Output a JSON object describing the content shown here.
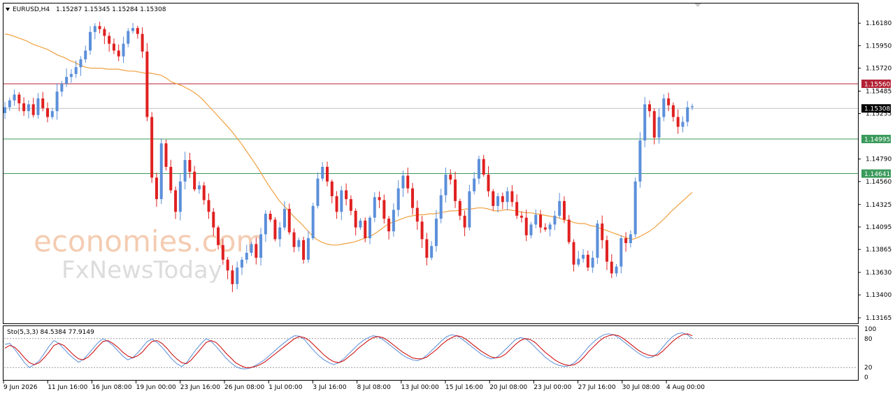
{
  "chart_data": [
    {
      "type": "candlestick",
      "symbol": "EURUSD,H4",
      "ohlc_readout": "1.15287 1.15345 1.15284 1.15308",
      "ylim": [
        1.1313,
        1.1636
      ],
      "y_ticks": [
        "1.16180",
        "1.15950",
        "1.15720",
        "1.15485",
        "1.15255",
        "1.14790",
        "1.14560",
        "1.14325",
        "1.14095",
        "1.13865",
        "1.13630",
        "1.13400",
        "1.13165"
      ],
      "x_labels": [
        "9 Jun 2026",
        "11 Jun 16:00",
        "16 Jun 08:00",
        "19 Jun 00:00",
        "23 Jun 16:00",
        "26 Jun 08:00",
        "1 Jul 00:00",
        "3 Jul 16:00",
        "8 Jul 08:00",
        "13 Jul 00:00",
        "15 Jul 16:00",
        "20 Jul 08:00",
        "23 Jul 00:00",
        "27 Jul 16:00",
        "30 Jul 08:00",
        "4 Aug 00:00"
      ],
      "horizontal_lines": [
        {
          "label": "1.15560",
          "value": 1.1556,
          "color": "#b22234"
        },
        {
          "label": "1.15308",
          "value": 1.15308,
          "color": "#000000"
        },
        {
          "label": "1.14995",
          "value": 1.14995,
          "color": "#3a9a5b"
        },
        {
          "label": "1.14641",
          "value": 1.14641,
          "color": "#3a9a5b"
        }
      ],
      "moving_average_color": "#f0a040",
      "bull_color": "#5b8fd9",
      "bear_color": "#e02020",
      "closes": [
        1.1532,
        1.1539,
        1.1545,
        1.1536,
        1.1528,
        1.1535,
        1.1524,
        1.1541,
        1.1531,
        1.1522,
        1.1528,
        1.1548,
        1.1556,
        1.1563,
        1.1566,
        1.1573,
        1.1581,
        1.159,
        1.1609,
        1.1615,
        1.1612,
        1.1605,
        1.1597,
        1.159,
        1.1584,
        1.1597,
        1.161,
        1.1613,
        1.1607,
        1.1589,
        1.1522,
        1.146,
        1.1438,
        1.1495,
        1.1471,
        1.1447,
        1.1425,
        1.1456,
        1.1478,
        1.1466,
        1.1448,
        1.1452,
        1.1437,
        1.1425,
        1.1409,
        1.1391,
        1.1376,
        1.1365,
        1.1351,
        1.1368,
        1.1376,
        1.1383,
        1.1392,
        1.1378,
        1.1402,
        1.1423,
        1.1417,
        1.1397,
        1.1409,
        1.1428,
        1.1404,
        1.1389,
        1.1396,
        1.1376,
        1.1398,
        1.1431,
        1.1459,
        1.1471,
        1.1456,
        1.1441,
        1.1425,
        1.1447,
        1.1438,
        1.1426,
        1.1409,
        1.1416,
        1.1398,
        1.1419,
        1.144,
        1.1437,
        1.1418,
        1.1405,
        1.1427,
        1.1449,
        1.1462,
        1.1449,
        1.1429,
        1.1415,
        1.1397,
        1.1378,
        1.139,
        1.1418,
        1.1442,
        1.1463,
        1.1458,
        1.1436,
        1.1421,
        1.1409,
        1.1446,
        1.1459,
        1.1479,
        1.1463,
        1.1446,
        1.1431,
        1.1441,
        1.1435,
        1.1446,
        1.1435,
        1.1421,
        1.1419,
        1.1401,
        1.1412,
        1.1422,
        1.1409,
        1.1407,
        1.1412,
        1.1421,
        1.1436,
        1.1417,
        1.1394,
        1.1371,
        1.1377,
        1.1381,
        1.1368,
        1.1378,
        1.1413,
        1.1396,
        1.1374,
        1.1362,
        1.1369,
        1.1398,
        1.1393,
        1.1402,
        1.1456,
        1.1498,
        1.1535,
        1.1528,
        1.1501,
        1.1522,
        1.1541,
        1.1534,
        1.1522,
        1.1512,
        1.1517,
        1.1532,
        1.1533
      ],
      "ma_values": [
        1.1607,
        1.1606,
        1.1604,
        1.1602,
        1.16,
        1.1597,
        1.1595,
        1.1593,
        1.1591,
        1.1588,
        1.1585,
        1.1583,
        1.158,
        1.1578,
        1.1575,
        1.1573,
        1.1572,
        1.1572,
        1.1572,
        1.1571,
        1.1571,
        1.1571,
        1.157,
        1.1569,
        1.1569,
        1.1568,
        1.1567,
        1.1567,
        1.1566,
        1.1565,
        1.1562,
        1.1558,
        1.1556,
        1.1554,
        1.1551,
        1.1548,
        1.1544,
        1.1539,
        1.1533,
        1.1527,
        1.1521,
        1.1515,
        1.1509,
        1.1502,
        1.1495,
        1.1487,
        1.1479,
        1.1471,
        1.1462,
        1.1453,
        1.1445,
        1.1437,
        1.1431,
        1.1425,
        1.1419,
        1.1414,
        1.1408,
        1.1402,
        1.1397,
        1.1394,
        1.1392,
        1.1391,
        1.1391,
        1.1392,
        1.1393,
        1.1394,
        1.1396,
        1.1398,
        1.14,
        1.1403,
        1.1407,
        1.1411,
        1.1414,
        1.1416,
        1.1418,
        1.142,
        1.1421,
        1.1422,
        1.1422,
        1.1423,
        1.1423,
        1.1424,
        1.1425,
        1.1426,
        1.1426,
        1.1427,
        1.1428,
        1.1428,
        1.1429,
        1.1429,
        1.1428,
        1.1426,
        1.1426,
        1.1427,
        1.1427,
        1.1426,
        1.1425,
        1.1424,
        1.1424,
        1.1423,
        1.1422,
        1.1421,
        1.142,
        1.1419,
        1.1417,
        1.1416,
        1.1414,
        1.1413,
        1.1413,
        1.1411,
        1.141,
        1.1408,
        1.1406,
        1.1404,
        1.1402,
        1.14,
        1.1398,
        1.1397,
        1.1399,
        1.1402,
        1.1405,
        1.1409,
        1.1414,
        1.1419,
        1.1425,
        1.143,
        1.1435,
        1.144,
        1.1445
      ]
    },
    {
      "type": "line",
      "name": "Sto(5,3,3) 84.5384 77.9149",
      "ylim": [
        0,
        100
      ],
      "y_ticks": [
        "100",
        "80",
        "20",
        "0"
      ],
      "levels": [
        80,
        20
      ],
      "main_color": "#5b8fd9",
      "signal_color": "#cc0000",
      "main": [
        68,
        70,
        58,
        44,
        30,
        20,
        26,
        34,
        49,
        64,
        76,
        70,
        59,
        48,
        39,
        31,
        37,
        48,
        60,
        72,
        80,
        74,
        66,
        55,
        44,
        36,
        40,
        50,
        62,
        74,
        79,
        72,
        62,
        50,
        38,
        28,
        22,
        30,
        44,
        58,
        70,
        80,
        74,
        64,
        52,
        40,
        30,
        22,
        18,
        17,
        19,
        24,
        30,
        37,
        46,
        55,
        64,
        72,
        80,
        86,
        85,
        78,
        66,
        54,
        44,
        36,
        30,
        26,
        30,
        38,
        48,
        58,
        68,
        76,
        82,
        86,
        84,
        78,
        70,
        62,
        54,
        46,
        40,
        36,
        34,
        38,
        46,
        56,
        66,
        76,
        84,
        88,
        86,
        80,
        72,
        64,
        56,
        48,
        42,
        38,
        40,
        48,
        58,
        68,
        78,
        82,
        80,
        72,
        62,
        52,
        42,
        34,
        28,
        24,
        22,
        24,
        30,
        40,
        52,
        64,
        74,
        82,
        88,
        90,
        88,
        82,
        74,
        66,
        58,
        50,
        44,
        40,
        42,
        50,
        62,
        74,
        84,
        90,
        92,
        88,
        80
      ],
      "signal": [
        60,
        66,
        62,
        52,
        40,
        30,
        26,
        30,
        40,
        52,
        66,
        70,
        66,
        56,
        46,
        38,
        36,
        42,
        52,
        64,
        74,
        76,
        70,
        62,
        52,
        44,
        40,
        44,
        52,
        64,
        74,
        76,
        70,
        60,
        48,
        38,
        30,
        28,
        36,
        48,
        60,
        72,
        76,
        72,
        62,
        50,
        40,
        30,
        24,
        20,
        20,
        22,
        26,
        32,
        40,
        48,
        56,
        64,
        72,
        80,
        84,
        82,
        76,
        66,
        56,
        46,
        38,
        32,
        30,
        34,
        42,
        50,
        60,
        68,
        76,
        82,
        84,
        82,
        76,
        68,
        60,
        52,
        46,
        40,
        38,
        38,
        42,
        50,
        58,
        68,
        76,
        82,
        86,
        84,
        78,
        70,
        62,
        54,
        48,
        42,
        40,
        42,
        48,
        58,
        68,
        76,
        80,
        78,
        72,
        62,
        52,
        44,
        36,
        30,
        26,
        24,
        26,
        32,
        42,
        54,
        64,
        74,
        82,
        86,
        88,
        86,
        80,
        72,
        64,
        56,
        50,
        46,
        44,
        46,
        54,
        64,
        74,
        82,
        88,
        90,
        86
      ]
    }
  ]
}
